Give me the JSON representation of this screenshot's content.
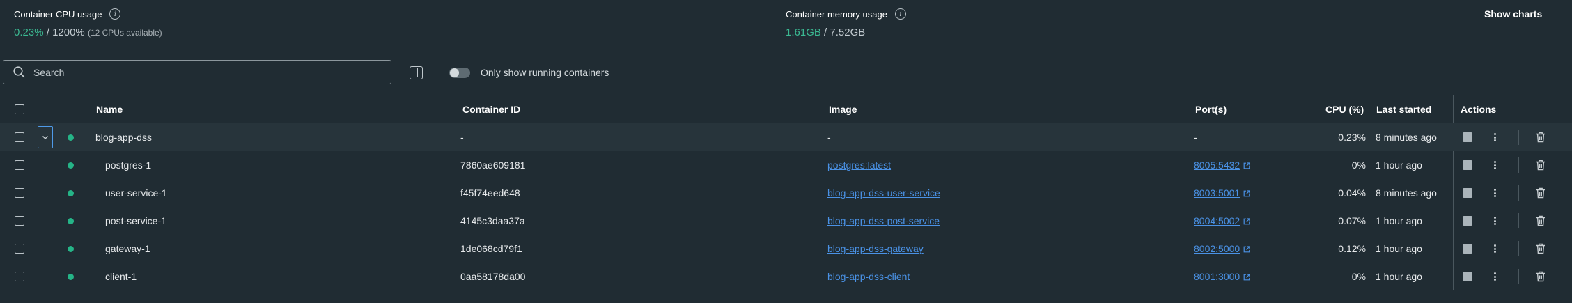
{
  "stats": {
    "cpu": {
      "label": "Container CPU usage",
      "used": "0.23%",
      "separator": " / ",
      "total": "1200%",
      "note": "(12 CPUs available)"
    },
    "memory": {
      "label": "Container memory usage",
      "used": "1.61GB",
      "separator": " / ",
      "total": "7.52GB"
    },
    "show_charts": "Show charts"
  },
  "toolbar": {
    "search_placeholder": "Search",
    "toggle_label": "Only show running containers",
    "running_only": false
  },
  "table": {
    "headers": {
      "name": "Name",
      "container_id": "Container ID",
      "image": "Image",
      "ports": "Port(s)",
      "cpu": "CPU (%)",
      "last_started": "Last started",
      "actions": "Actions"
    },
    "group": {
      "name": "blog-app-dss",
      "container_id": "-",
      "image": "-",
      "ports": "-",
      "cpu": "0.23%",
      "last_started": "8 minutes ago",
      "status": "running",
      "expanded": true
    },
    "rows": [
      {
        "name": "postgres-1",
        "container_id": "7860ae609181",
        "image": "postgres:latest",
        "ports": "8005:5432",
        "cpu": "0%",
        "last_started": "1 hour ago",
        "status": "running"
      },
      {
        "name": "user-service-1",
        "container_id": "f45f74eed648",
        "image": "blog-app-dss-user-service",
        "ports": "8003:5001",
        "cpu": "0.04%",
        "last_started": "8 minutes ago",
        "status": "running"
      },
      {
        "name": "post-service-1",
        "container_id": "4145c3daa37a",
        "image": "blog-app-dss-post-service",
        "ports": "8004:5002",
        "cpu": "0.07%",
        "last_started": "1 hour ago",
        "status": "running"
      },
      {
        "name": "gateway-1",
        "container_id": "1de068cd79f1",
        "image": "blog-app-dss-gateway",
        "ports": "8002:5000",
        "cpu": "0.12%",
        "last_started": "1 hour ago",
        "status": "running"
      },
      {
        "name": "client-1",
        "container_id": "0aa58178da00",
        "image": "blog-app-dss-client",
        "ports": "8001:3000",
        "cpu": "0%",
        "last_started": "1 hour ago",
        "status": "running"
      }
    ]
  },
  "colors": {
    "background": "#202c33",
    "accent_green": "#3bb992",
    "status_running": "#25b487",
    "link_blue": "#4a92e6"
  },
  "icons": {
    "info": "info-icon",
    "search": "search-icon",
    "columns": "columns-icon",
    "expand": "chevron-down-icon",
    "stop": "stop-icon",
    "more": "kebab-menu-icon",
    "delete": "trash-icon",
    "external_link": "external-link-icon"
  }
}
